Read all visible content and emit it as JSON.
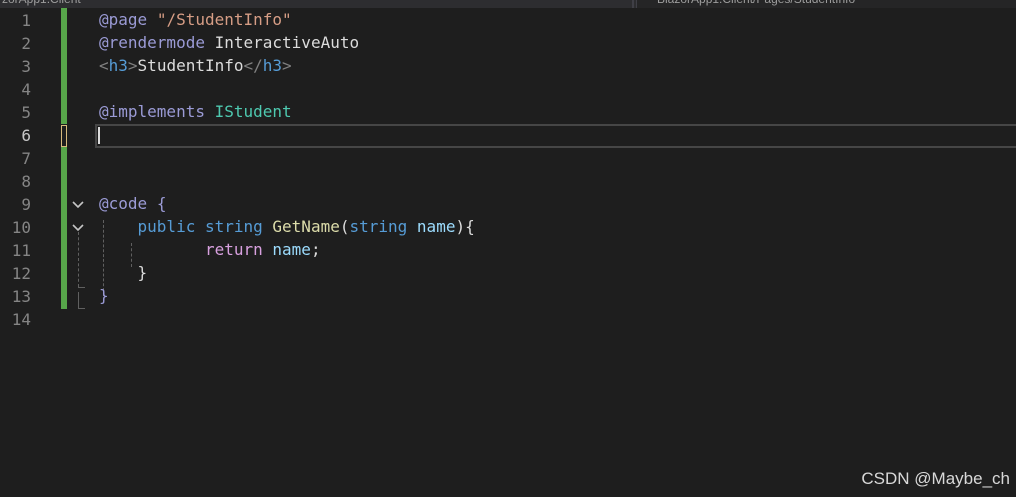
{
  "tabs": {
    "left_label": "zorApp1.Client",
    "right_label": "BlazorApp1.Client/Pages/StudentInfo"
  },
  "editor": {
    "line_numbers": [
      "1",
      "2",
      "3",
      "4",
      "5",
      "6",
      "7",
      "8",
      "9",
      "10",
      "11",
      "12",
      "13",
      "14"
    ],
    "current_line": "6",
    "lines": {
      "l1": {
        "dir": "@page",
        "str": "\"/StudentInfo\""
      },
      "l2": {
        "dir": "@rendermode",
        "value": "InteractiveAuto"
      },
      "l3": {
        "open_lt": "<",
        "open_tag": "h3",
        "open_gt": ">",
        "text": "StudentInfo",
        "close_lt": "</",
        "close_tag": "h3",
        "close_gt": ">"
      },
      "l5": {
        "dir": "@implements",
        "type": "IStudent"
      },
      "l9": {
        "dir": "@code",
        "brace": "{"
      },
      "l10": {
        "kw1": "public",
        "kw2": "string",
        "method": "GetName",
        "paren_open": "(",
        "param_type": "string",
        "param": "name",
        "paren_close": ")",
        "brace": "{"
      },
      "l11": {
        "kw": "return",
        "value": "name",
        "semi": ";"
      },
      "l12": {
        "brace": "}"
      },
      "l13": {
        "brace": "}"
      }
    }
  },
  "icons": {
    "fold_9": "chevron-down-icon",
    "fold_10": "chevron-down-icon"
  },
  "colors": {
    "background": "#1e1e1e",
    "change_bar": "#57a64a",
    "directive": "#9b9bd6",
    "keyword": "#569cd6",
    "method": "#dcdcaa",
    "parameter": "#9cdcfe",
    "string": "#d69d85"
  },
  "watermark": "CSDN @Maybe_ch"
}
